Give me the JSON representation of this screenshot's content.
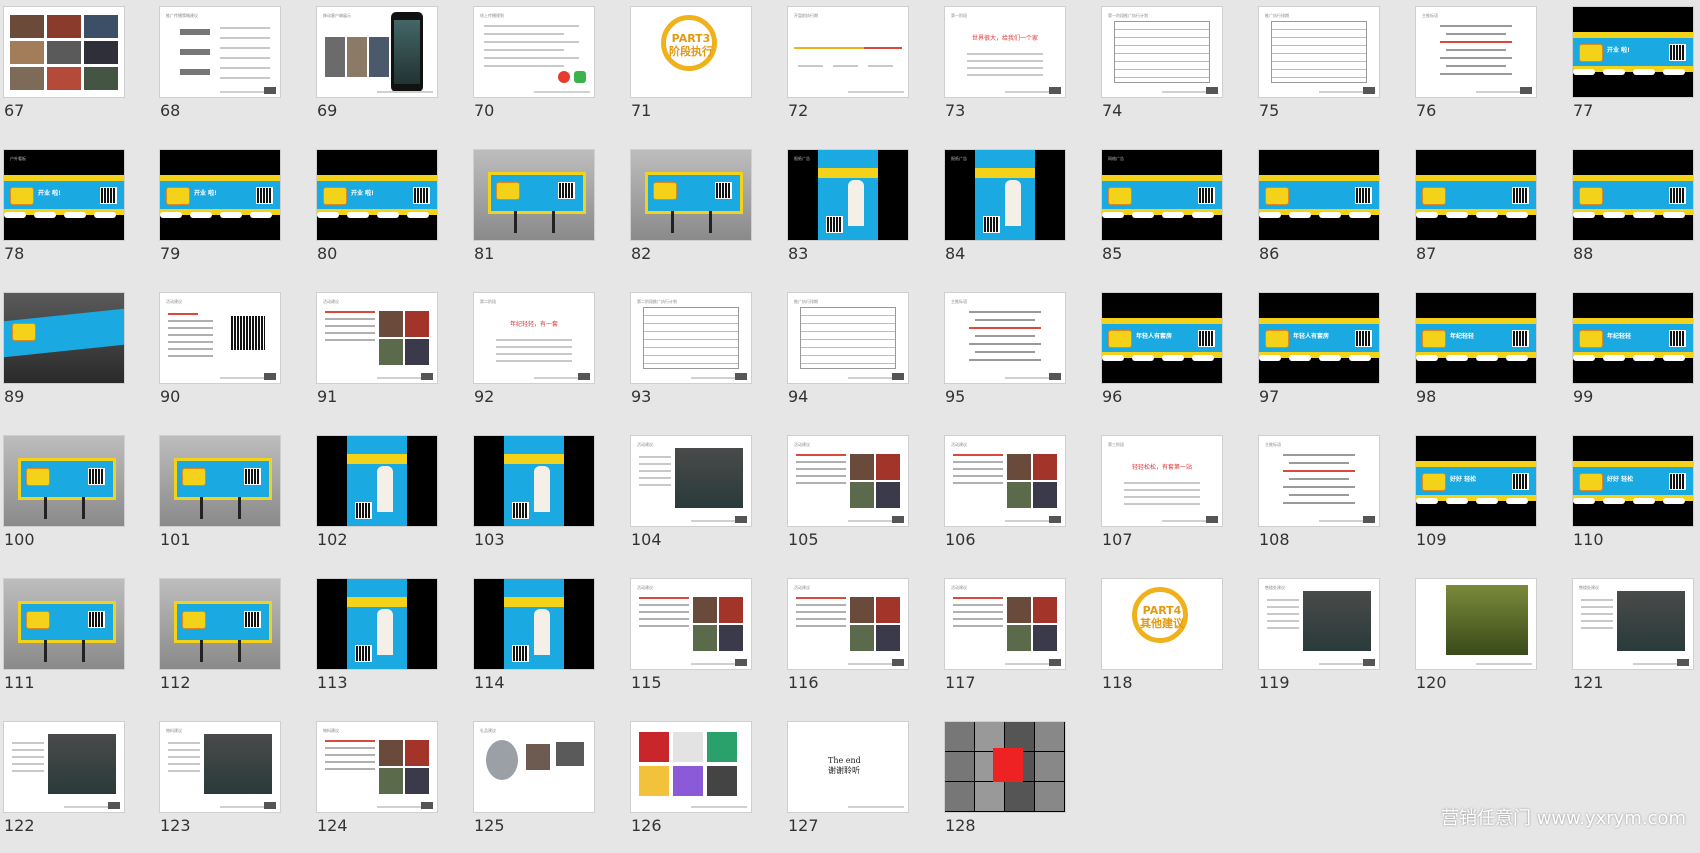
{
  "app": {
    "name": "slide-sorter"
  },
  "watermark": "营销任意门 www.yxrym.com",
  "grid": {
    "first_row_numbers": 67,
    "columns": 11
  },
  "slides": [
    {
      "number": "67",
      "kind": "photo-collage"
    },
    {
      "number": "68",
      "kind": "text-flow",
      "caption": "推广传播策略建议"
    },
    {
      "number": "69",
      "kind": "phone-mock",
      "caption": "移动客户端展示"
    },
    {
      "number": "70",
      "kind": "text-icons",
      "caption": "线上传播规划"
    },
    {
      "number": "71",
      "kind": "part",
      "title_top": "PART3",
      "title_bottom": "阶段执行"
    },
    {
      "number": "72",
      "kind": "timeline",
      "caption": "开盘前执行期"
    },
    {
      "number": "73",
      "kind": "redtitle",
      "caption": "第一阶段",
      "headline": "世界很大，给我们一个家"
    },
    {
      "number": "74",
      "kind": "table",
      "caption": "第一阶段推广执行计划"
    },
    {
      "number": "75",
      "kind": "table",
      "caption": "推广执行排期"
    },
    {
      "number": "76",
      "kind": "text-center",
      "caption": "主推标语"
    },
    {
      "number": "77",
      "kind": "banner-dark",
      "banner_title": "开业 啦!",
      "caption": ""
    },
    {
      "number": "78",
      "kind": "banner-dark",
      "banner_title": "开业 啦!",
      "caption": "户外看板"
    },
    {
      "number": "79",
      "kind": "banner-dark",
      "banner_title": "开业 啦!",
      "caption": ""
    },
    {
      "number": "80",
      "kind": "banner-dark",
      "banner_title": "开业 啦!",
      "caption": ""
    },
    {
      "number": "81",
      "kind": "billboard",
      "caption": ""
    },
    {
      "number": "82",
      "kind": "billboard",
      "caption": "户外广告"
    },
    {
      "number": "83",
      "kind": "poster-dark",
      "caption": "报纸广告"
    },
    {
      "number": "84",
      "kind": "poster-dark",
      "caption": "报纸广告"
    },
    {
      "number": "85",
      "kind": "banner-dark",
      "banner_title": "",
      "caption": "网络广告"
    },
    {
      "number": "86",
      "kind": "banner-dark",
      "banner_title": "",
      "caption": ""
    },
    {
      "number": "87",
      "kind": "banner-dark",
      "banner_title": "",
      "caption": ""
    },
    {
      "number": "88",
      "kind": "banner-dark",
      "banner_title": "",
      "caption": ""
    },
    {
      "number": "89",
      "kind": "street",
      "caption": ""
    },
    {
      "number": "90",
      "kind": "text-qr",
      "caption": "活动建议"
    },
    {
      "number": "91",
      "kind": "text-photos",
      "caption": "活动建议"
    },
    {
      "number": "92",
      "kind": "redtitle",
      "caption": "第二阶段",
      "headline": "年纪轻轻，有一套"
    },
    {
      "number": "93",
      "kind": "table",
      "caption": "第二阶段推广执行计划"
    },
    {
      "number": "94",
      "kind": "table",
      "caption": "推广执行排期"
    },
    {
      "number": "95",
      "kind": "text-center",
      "caption": "主推标语"
    },
    {
      "number": "96",
      "kind": "banner-dark",
      "banner_title": "年轻人有套房",
      "caption": ""
    },
    {
      "number": "97",
      "kind": "banner-dark",
      "banner_title": "年轻人有套房",
      "caption": ""
    },
    {
      "number": "98",
      "kind": "banner-dark",
      "banner_title": "年纪轻轻",
      "caption": ""
    },
    {
      "number": "99",
      "kind": "banner-dark",
      "banner_title": "年纪轻轻",
      "caption": ""
    },
    {
      "number": "100",
      "kind": "billboard",
      "caption": ""
    },
    {
      "number": "101",
      "kind": "billboard",
      "caption": ""
    },
    {
      "number": "102",
      "kind": "poster-dark",
      "caption": ""
    },
    {
      "number": "103",
      "kind": "poster-dark",
      "caption": ""
    },
    {
      "number": "104",
      "kind": "text-photo",
      "caption": "活动建议"
    },
    {
      "number": "105",
      "kind": "text-photos",
      "caption": "活动建议"
    },
    {
      "number": "106",
      "kind": "text-photos",
      "caption": "活动建议"
    },
    {
      "number": "107",
      "kind": "redtitle",
      "caption": "第三阶段",
      "headline": "轻轻松松，有套第一站"
    },
    {
      "number": "108",
      "kind": "text-center",
      "caption": "主推标语"
    },
    {
      "number": "109",
      "kind": "banner-dark",
      "banner_title": "好好 轻松",
      "caption": ""
    },
    {
      "number": "110",
      "kind": "banner-dark",
      "banner_title": "好好 轻松",
      "caption": ""
    },
    {
      "number": "111",
      "kind": "billboard",
      "caption": ""
    },
    {
      "number": "112",
      "kind": "billboard",
      "caption": ""
    },
    {
      "number": "113",
      "kind": "poster-dark",
      "caption": ""
    },
    {
      "number": "114",
      "kind": "poster-dark",
      "caption": ""
    },
    {
      "number": "115",
      "kind": "text-photos",
      "caption": "活动建议"
    },
    {
      "number": "116",
      "kind": "text-photos",
      "caption": "活动建议"
    },
    {
      "number": "117",
      "kind": "text-photos",
      "caption": "活动建议"
    },
    {
      "number": "118",
      "kind": "part",
      "title_top": "PART4",
      "title_bottom": "其他建议"
    },
    {
      "number": "119",
      "kind": "text-photo",
      "caption": "售楼处建议"
    },
    {
      "number": "120",
      "kind": "photo-wide",
      "caption": ""
    },
    {
      "number": "121",
      "kind": "text-photo",
      "caption": "售楼处建议"
    },
    {
      "number": "122",
      "kind": "text-photo",
      "caption": ""
    },
    {
      "number": "123",
      "kind": "text-photo",
      "caption": "物料建议"
    },
    {
      "number": "124",
      "kind": "text-photos",
      "caption": "物料建议"
    },
    {
      "number": "125",
      "kind": "objects",
      "caption": "礼品建议"
    },
    {
      "number": "126",
      "kind": "collage-color",
      "caption": ""
    },
    {
      "number": "127",
      "kind": "end",
      "end_line1": "The  end",
      "end_line2": "谢谢聆听"
    },
    {
      "number": "128",
      "kind": "bw-collage",
      "caption": ""
    }
  ],
  "colors": {
    "banner_blue": "#1ba9e1",
    "banner_yellow": "#f5d21a",
    "accent_red": "#d94a3c",
    "part_orange": "#e29a12"
  }
}
